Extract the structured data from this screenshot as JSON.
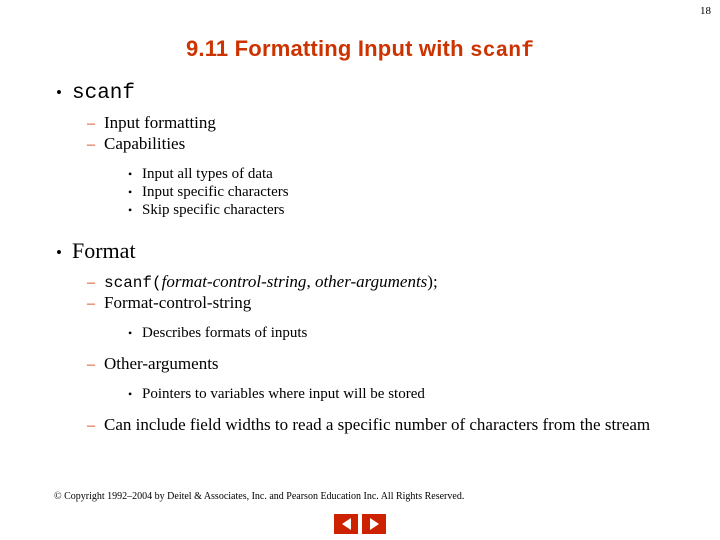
{
  "slide": {
    "page_number": "18",
    "title_plain": "9.11  Formatting Input with ",
    "title_mono": "scanf",
    "title_color": "#cc3300",
    "copyright": "© Copyright 1992–2004 by Deitel & Associates, Inc. and Pearson Education Inc. All Rights Reserved."
  },
  "content": {
    "item1": "scanf",
    "item1_sub1": "Input formatting",
    "item1_sub2": "Capabilities",
    "item1_sub2_a": "Input all types of data",
    "item1_sub2_b": "Input specific characters",
    "item1_sub2_c": "Skip specific characters",
    "item2": "Format",
    "item2_sub1_mono": "scanf(",
    "item2_sub1_ital1": "format-control-string",
    "item2_sub1_sep": ", ",
    "item2_sub1_ital2": "other-arguments",
    "item2_sub1_end": ");",
    "item2_sub2": "Format-control-string",
    "item2_sub2_a": "Describes formats of inputs",
    "item2_sub3": "Other-arguments",
    "item2_sub3_a": "Pointers to variables where input will be stored",
    "item2_sub4": "Can include field widths to read a specific number of characters from the stream"
  },
  "nav": {
    "prev_label": "previous-slide",
    "next_label": "next-slide",
    "button_color": "#cc2200"
  },
  "glyphs": {
    "bullet_l1": "•",
    "dash_l2": "–",
    "bullet_l3": "•"
  }
}
